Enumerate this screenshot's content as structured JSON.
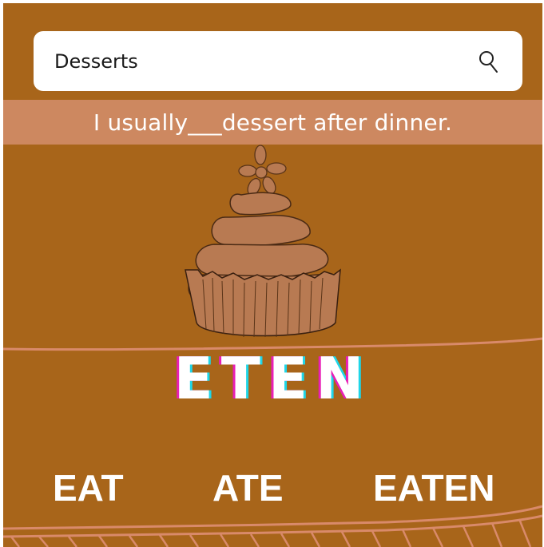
{
  "search": {
    "value": "Desserts",
    "icon": "search-icon"
  },
  "prompt": {
    "sentence": "I usually___dessert after dinner."
  },
  "illustration": {
    "icon": "cupcake-icon"
  },
  "word": {
    "text": "ETEN"
  },
  "choices": [
    {
      "label": "EAT"
    },
    {
      "label": "ATE"
    },
    {
      "label": "EATEN"
    }
  ],
  "colors": {
    "background": "#a8651a",
    "band": "#cd8860",
    "frosting": "#b87a52",
    "base": "#d4935e",
    "glitch_magenta": "#e81fb7",
    "glitch_cyan": "#1fd6e8"
  }
}
